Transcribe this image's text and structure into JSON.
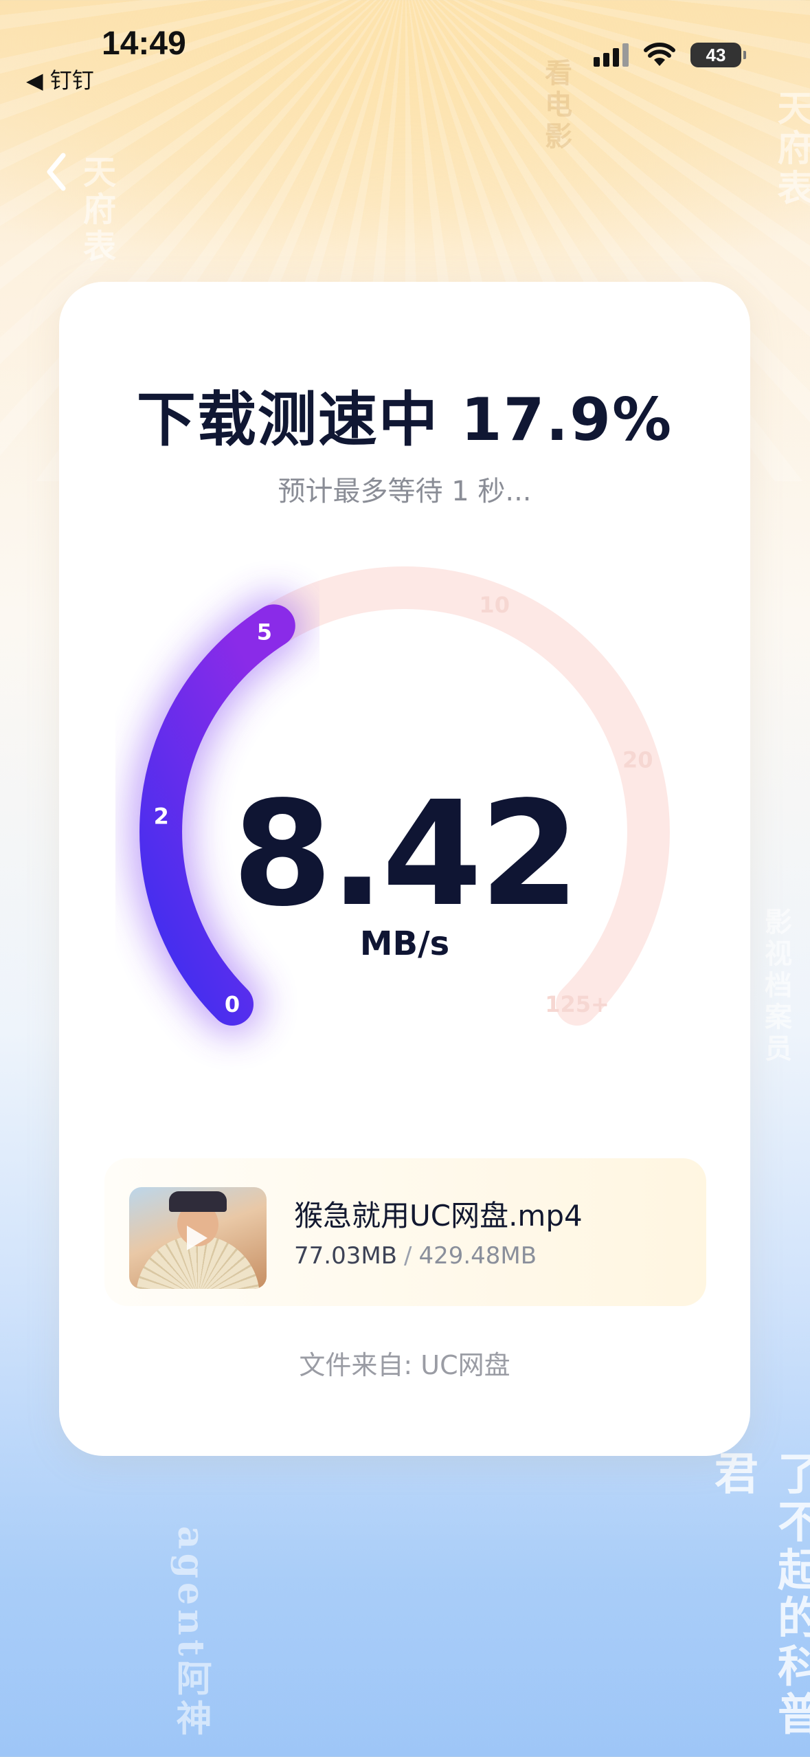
{
  "status_bar": {
    "time": "14:49",
    "back_app": "◀ 钉钉",
    "battery": "43"
  },
  "background_text": {
    "left_top": "天府表",
    "right_top_1": "天府表",
    "right_top_2": "看电影",
    "right_bottom": "了不起的科普君",
    "left_bottom": "agent阿神",
    "right_mid": "影视档案员"
  },
  "card": {
    "title": "下载测速中 17.9%",
    "subtitle": "预计最多等待 1 秒..."
  },
  "gauge": {
    "ticks": [
      "0",
      "2",
      "5",
      "10",
      "20",
      "125+"
    ],
    "progress_fraction": 0.179,
    "active_color_start": "#3b2ff0",
    "active_color_end": "#8a2be8",
    "track_color": "#fde7e4"
  },
  "speed": {
    "value": "8.42",
    "unit": "MB/s"
  },
  "file": {
    "name": "猴急就用UC网盘.mp4",
    "downloaded": "77.03MB",
    "separator": "/",
    "total": "429.48MB"
  },
  "source": "文件来自: UC网盘"
}
